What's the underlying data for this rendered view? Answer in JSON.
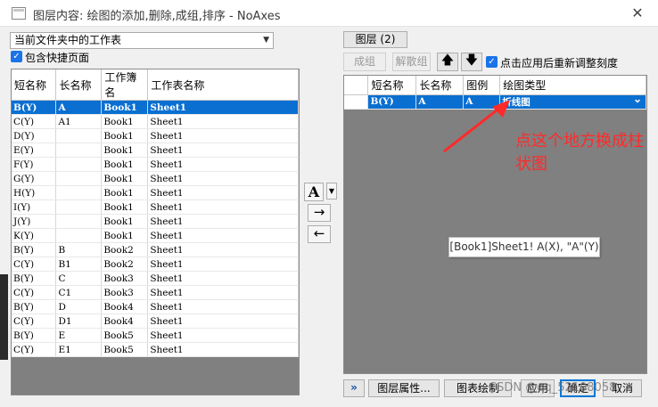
{
  "window": {
    "title": "图层内容: 绘图的添加,删除,成组,排序 - NoAxes",
    "close_glyph": "✕"
  },
  "left": {
    "dropdown_value": "当前文件夹中的工作表",
    "include_shortcuts_label": "包含快捷页面",
    "columns": [
      "短名称",
      "长名称",
      "工作簿名",
      "工作表名称"
    ],
    "rows": [
      [
        "B(Y)",
        "A",
        "Book1",
        "Sheet1"
      ],
      [
        "C(Y)",
        "A1",
        "Book1",
        "Sheet1"
      ],
      [
        "D(Y)",
        "",
        "Book1",
        "Sheet1"
      ],
      [
        "E(Y)",
        "",
        "Book1",
        "Sheet1"
      ],
      [
        "F(Y)",
        "",
        "Book1",
        "Sheet1"
      ],
      [
        "G(Y)",
        "",
        "Book1",
        "Sheet1"
      ],
      [
        "H(Y)",
        "",
        "Book1",
        "Sheet1"
      ],
      [
        "I(Y)",
        "",
        "Book1",
        "Sheet1"
      ],
      [
        "J(Y)",
        "",
        "Book1",
        "Sheet1"
      ],
      [
        "K(Y)",
        "",
        "Book1",
        "Sheet1"
      ],
      [
        "B(Y)",
        "B",
        "Book2",
        "Sheet1"
      ],
      [
        "C(Y)",
        "B1",
        "Book2",
        "Sheet1"
      ],
      [
        "B(Y)",
        "C",
        "Book3",
        "Sheet1"
      ],
      [
        "C(Y)",
        "C1",
        "Book3",
        "Sheet1"
      ],
      [
        "B(Y)",
        "D",
        "Book4",
        "Sheet1"
      ],
      [
        "C(Y)",
        "D1",
        "Book4",
        "Sheet1"
      ],
      [
        "B(Y)",
        "E",
        "Book5",
        "Sheet1"
      ],
      [
        "C(Y)",
        "E1",
        "Book5",
        "Sheet1"
      ]
    ]
  },
  "middle": {
    "font_glyph": "A",
    "add_glyph": "→",
    "remove_glyph": "←"
  },
  "right": {
    "layer_label": "图层 (2)",
    "group_btn": "成组",
    "ungroup_btn": "解散组",
    "rescale_label": "点击应用后重新调整刻度",
    "columns": [
      "短名称",
      "长名称",
      "图例",
      "绘图类型"
    ],
    "rows": [
      [
        "B(Y)",
        "A",
        "A",
        "折线图"
      ]
    ],
    "tooltip": "[Book1]Sheet1! A(X), \"A\"(Y)",
    "annotation": "点这个地方换成柱状图"
  },
  "footer": {
    "expand_glyph": "»",
    "layer_props_btn": "图层属性...",
    "chart_draw_btn": "图表绘制",
    "apply_btn": "应用",
    "ok_btn": "确定",
    "cancel_btn": "取消",
    "watermark": "CSDN @qq_52108058"
  },
  "colors": {
    "selection": "#0a6fd1",
    "checkbox": "#1a73e8",
    "annotation": "#ff2a2a"
  }
}
